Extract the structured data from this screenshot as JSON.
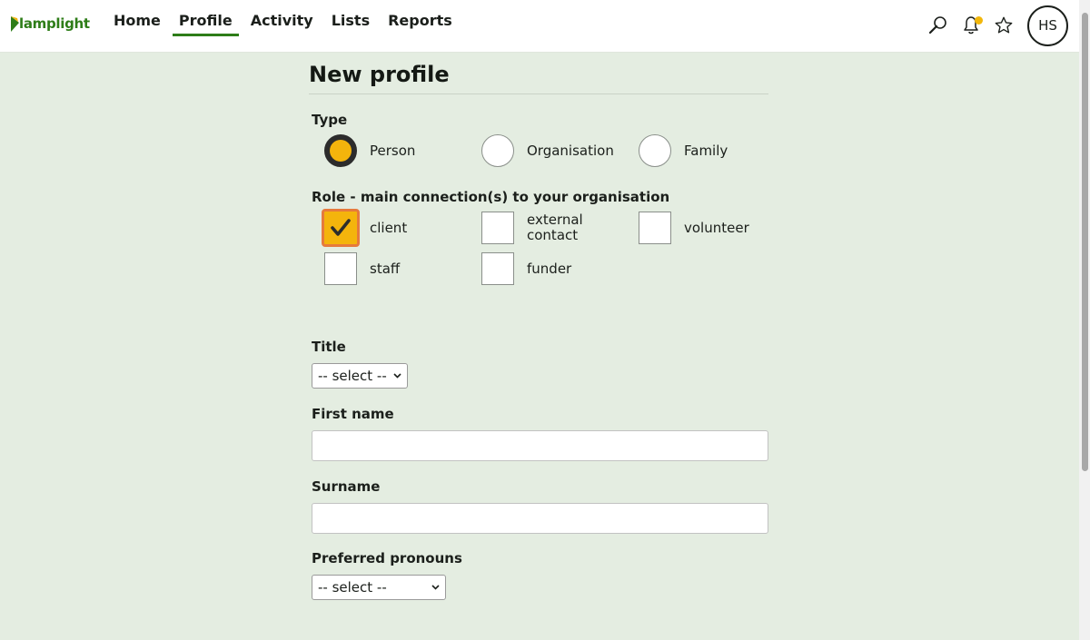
{
  "app": {
    "logo_text": "lamplight"
  },
  "nav": {
    "items": [
      "Home",
      "Profile",
      "Activity",
      "Lists",
      "Reports"
    ],
    "active": "Profile"
  },
  "header_icons": [
    "search-icon",
    "bell-icon",
    "star-icon"
  ],
  "user": {
    "initials": "HS"
  },
  "colors": {
    "accent": "#2e7d18",
    "highlight": "#f4b40c",
    "background": "#e4ede1"
  },
  "form": {
    "title": "New profile",
    "type": {
      "label": "Type",
      "options": [
        "Person",
        "Organisation",
        "Family"
      ],
      "selected": "Person"
    },
    "role": {
      "label": "Role - main connection(s) to your organisation",
      "options": [
        "client",
        "external contact",
        "volunteer",
        "staff",
        "funder"
      ],
      "checked": [
        "client"
      ]
    },
    "title_field": {
      "label": "Title",
      "value": "-- select --"
    },
    "first_name": {
      "label": "First name",
      "value": ""
    },
    "surname": {
      "label": "Surname",
      "value": ""
    },
    "pronouns": {
      "label": "Preferred pronouns",
      "value": "-- select --"
    }
  }
}
